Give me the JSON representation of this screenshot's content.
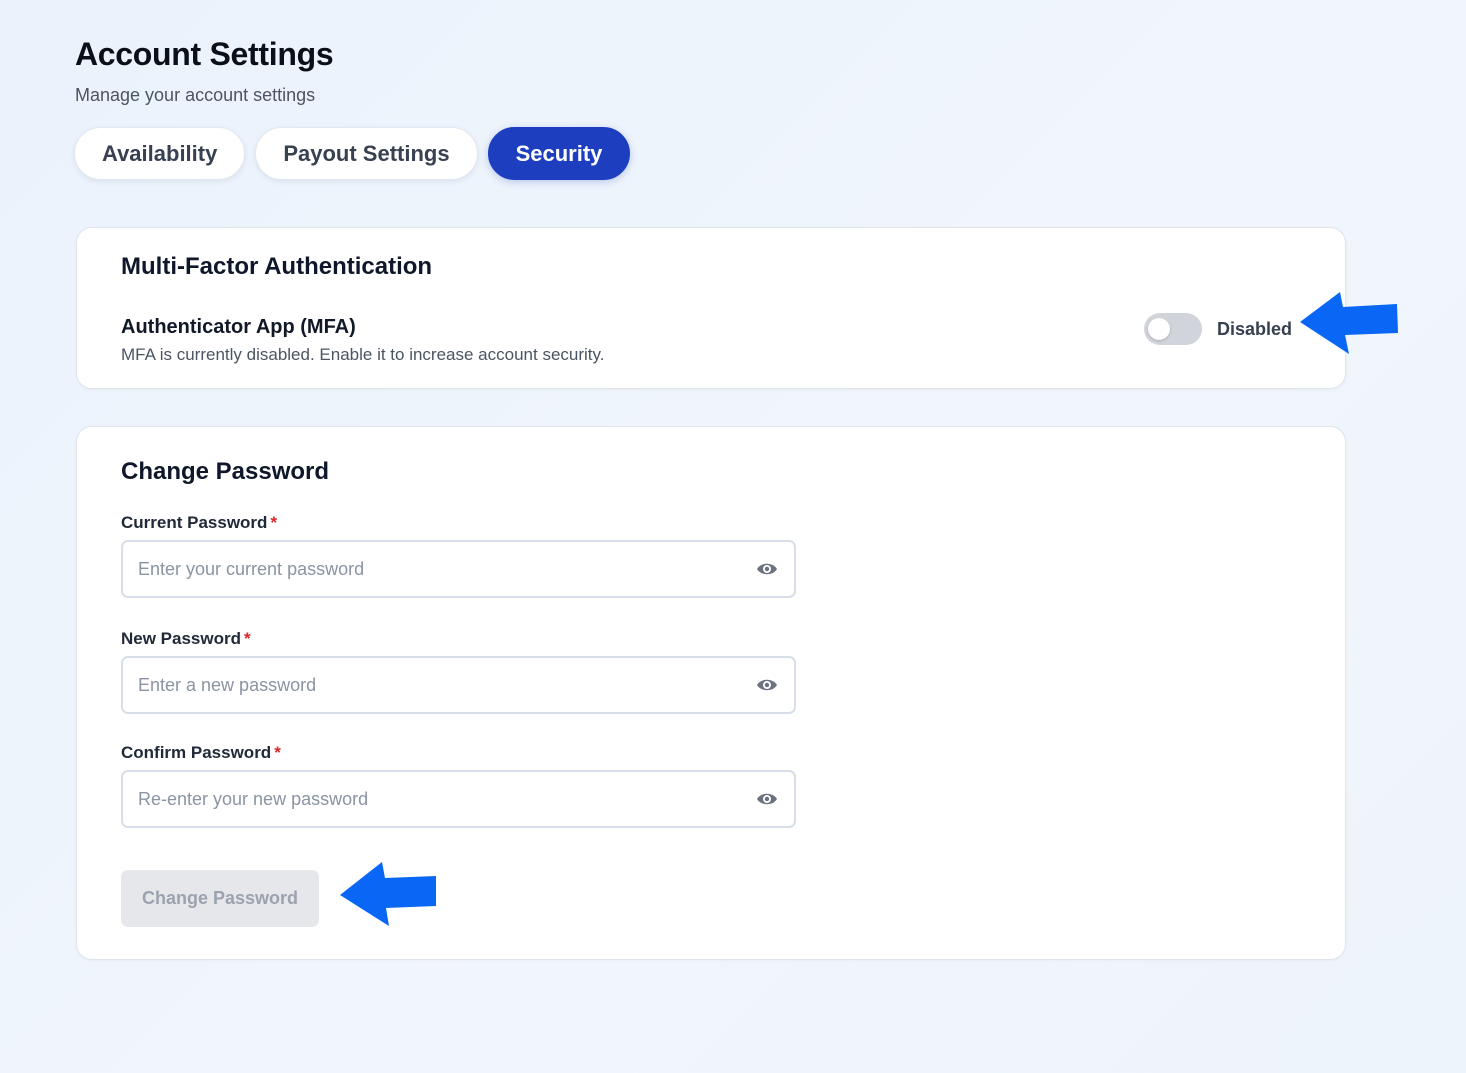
{
  "header": {
    "title": "Account Settings",
    "subtitle": "Manage your account settings"
  },
  "tabs": [
    {
      "label": "Availability",
      "active": false
    },
    {
      "label": "Payout Settings",
      "active": false
    },
    {
      "label": "Security",
      "active": true
    }
  ],
  "mfa": {
    "title": "Multi-Factor Authentication",
    "label": "Authenticator App (MFA)",
    "description": "MFA is currently disabled. Enable it to increase account security.",
    "toggle_on": false,
    "status": "Disabled"
  },
  "password": {
    "title": "Change Password",
    "fields": [
      {
        "label": "Current Password",
        "required": "*",
        "placeholder": "Enter your current password",
        "value": ""
      },
      {
        "label": "New Password",
        "required": "*",
        "placeholder": "Enter a new password",
        "value": ""
      },
      {
        "label": "Confirm Password",
        "required": "*",
        "placeholder": "Re-enter your new password",
        "value": ""
      }
    ],
    "submit_label": "Change Password",
    "submit_disabled": true
  },
  "colors": {
    "accent": "#1d3fbf",
    "annotation_arrow": "#0a66f5",
    "required": "#dc2626"
  },
  "icons": [
    "eye-icon",
    "arrow-left-icon"
  ]
}
